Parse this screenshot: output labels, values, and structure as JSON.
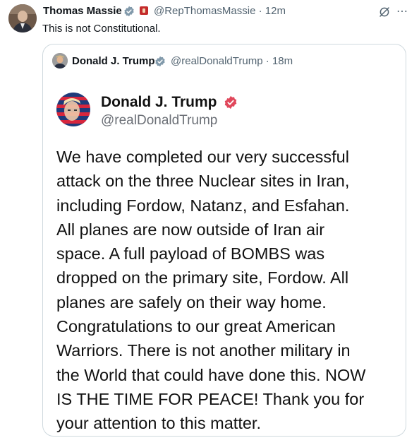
{
  "tweet": {
    "author_name": "Thomas Massie",
    "author_handle": "@RepThomasMassie · 12m",
    "text": "This is not Constitutional.",
    "more_icon": "⋯"
  },
  "quoted_tweet": {
    "author_name": "Donald J. Trump",
    "author_handle": "@realDonaldTrump · 18m"
  },
  "embedded_post": {
    "author_name": "Donald J. Trump",
    "author_handle": "@realDonaldTrump",
    "body_lines": [
      "We have completed our very successful",
      "attack on the three Nuclear sites in Iran,",
      "including Fordow, Natanz, and Esfahan.",
      "All planes are now outside of Iran air",
      "space. A full payload of BOMBS was",
      "dropped on the primary site, Fordow. All",
      "planes are safely on their way home.",
      "Congratulations to our great American",
      "Warriors. There is not another military in",
      "the World that could have done this. NOW",
      "IS THE TIME FOR PEACE! Thank you for",
      "your attention to this matter."
    ]
  },
  "colors": {
    "verified_blue": "#1d9bf0",
    "truth_badge_red": "#e0475b",
    "secondary_text": "#536471",
    "border": "#cfd9de"
  },
  "icons": [
    "verified-badge-icon",
    "government-badge-icon",
    "grok-icon",
    "more-icon",
    "truth-verified-icon"
  ]
}
